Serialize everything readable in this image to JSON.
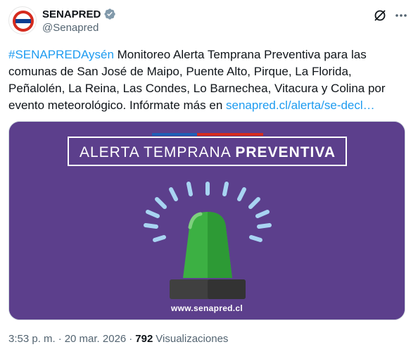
{
  "author": {
    "display_name": "SENAPRED",
    "handle": "@Senapred",
    "avatar_text": "SENAPRED",
    "verified": true
  },
  "tweet": {
    "hashtag": "#SENAPREDAysén",
    "text": " Monitoreo Alerta Temprana Preventiva para las comunas de San José de Maipo, Puente Alto, Pirque, La Florida, Peñalolén, La Reina, Las Condes, Lo Barnechea, Vitacura y Colina por evento meteorológico. Infórmate más en ",
    "link": "senapred.cl/alerta/se-decl…"
  },
  "media": {
    "banner_light": "ALERTA TEMPRANA ",
    "banner_bold": "PREVENTIVA",
    "site_url": "www.senapred.cl",
    "background_color": "#5c3f8c",
    "siren_color": "#3cb043"
  },
  "footer": {
    "time": "3:53 p. m.",
    "separator": "·",
    "date": "20 mar. 2026",
    "separator2": "·",
    "views_count": "792",
    "views_label": "Visualizaciones"
  },
  "icons": {
    "verified": "verified-badge-icon",
    "grok": "grok-icon",
    "more": "more-icon"
  }
}
